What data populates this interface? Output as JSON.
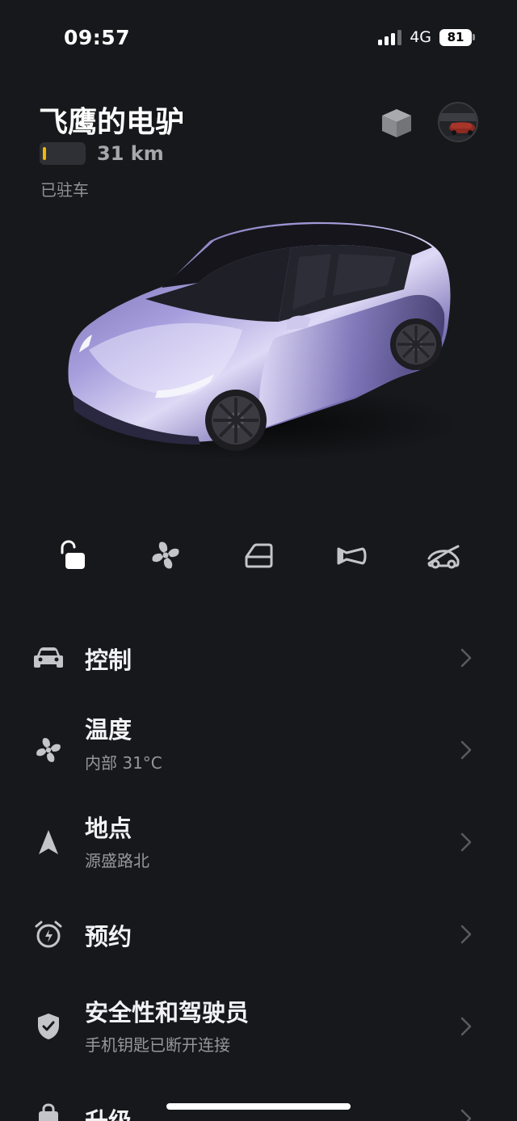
{
  "status_bar": {
    "time": "09:57",
    "network": "4G",
    "battery_percent": "81",
    "signal_bars_active": 3,
    "signal_bars_total": 4
  },
  "header": {
    "car_name": "飞鹰的电驴",
    "range": "31 km",
    "range_fraction": 0.05,
    "status": "已驻车",
    "model_icon": "cube-icon",
    "avatar_icon": "profile-avatar"
  },
  "quick_actions": [
    {
      "icon": "unlock-icon"
    },
    {
      "icon": "fan-icon"
    },
    {
      "icon": "frunk-icon"
    },
    {
      "icon": "horn-icon"
    },
    {
      "icon": "trunk-icon"
    }
  ],
  "menu": [
    {
      "icon": "car-icon",
      "title": "控制",
      "subtitle": ""
    },
    {
      "icon": "fan-icon",
      "title": "温度",
      "subtitle": "内部 31°C"
    },
    {
      "icon": "navigation-arrow-icon",
      "title": "地点",
      "subtitle": "源盛路北"
    },
    {
      "icon": "alarm-clock-icon",
      "title": "预约",
      "subtitle": ""
    },
    {
      "icon": "shield-check-icon",
      "title": "安全性和驾驶员",
      "subtitle": "手机钥匙已断开连接"
    },
    {
      "icon": "shopping-bag-icon",
      "title": "升级",
      "subtitle": ""
    }
  ],
  "colors": {
    "background": "#17181b",
    "text_primary": "#f2f2f4",
    "text_secondary": "#96979b",
    "range_warning": "#f2b705",
    "car_paint": "#8f86c4"
  }
}
